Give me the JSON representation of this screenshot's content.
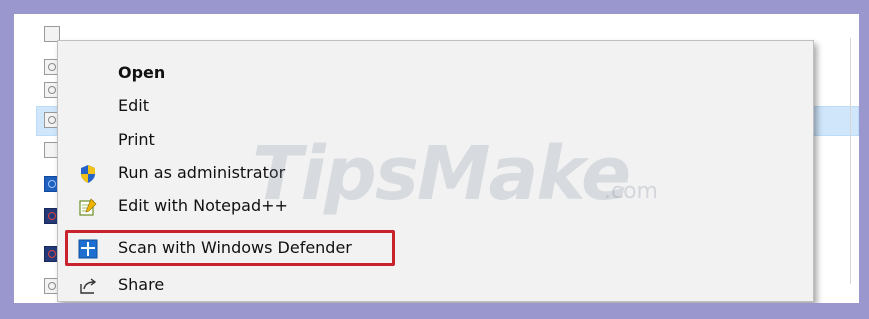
{
  "context_menu": {
    "items": [
      {
        "label": "Open",
        "bold": true,
        "icon": null
      },
      {
        "label": "Edit",
        "icon": null
      },
      {
        "label": "Print",
        "icon": null
      },
      {
        "label": "Run as administrator",
        "icon": "uac-shield-icon"
      },
      {
        "label": "Edit with Notepad++",
        "icon": "notepad-plus-plus-icon"
      },
      {
        "label": "Scan with Windows Defender",
        "icon": "windows-defender-icon",
        "highlighted": true
      },
      {
        "label": "Share",
        "icon": "share-icon"
      }
    ]
  },
  "watermark": {
    "brand": "TipsMake",
    "suffix": ".com"
  },
  "colors": {
    "outer_frame": "#9a97cf",
    "menu_background": "#f2f2f2",
    "highlight_box": "#c8232c",
    "selected_row": "#cfe6fb"
  }
}
